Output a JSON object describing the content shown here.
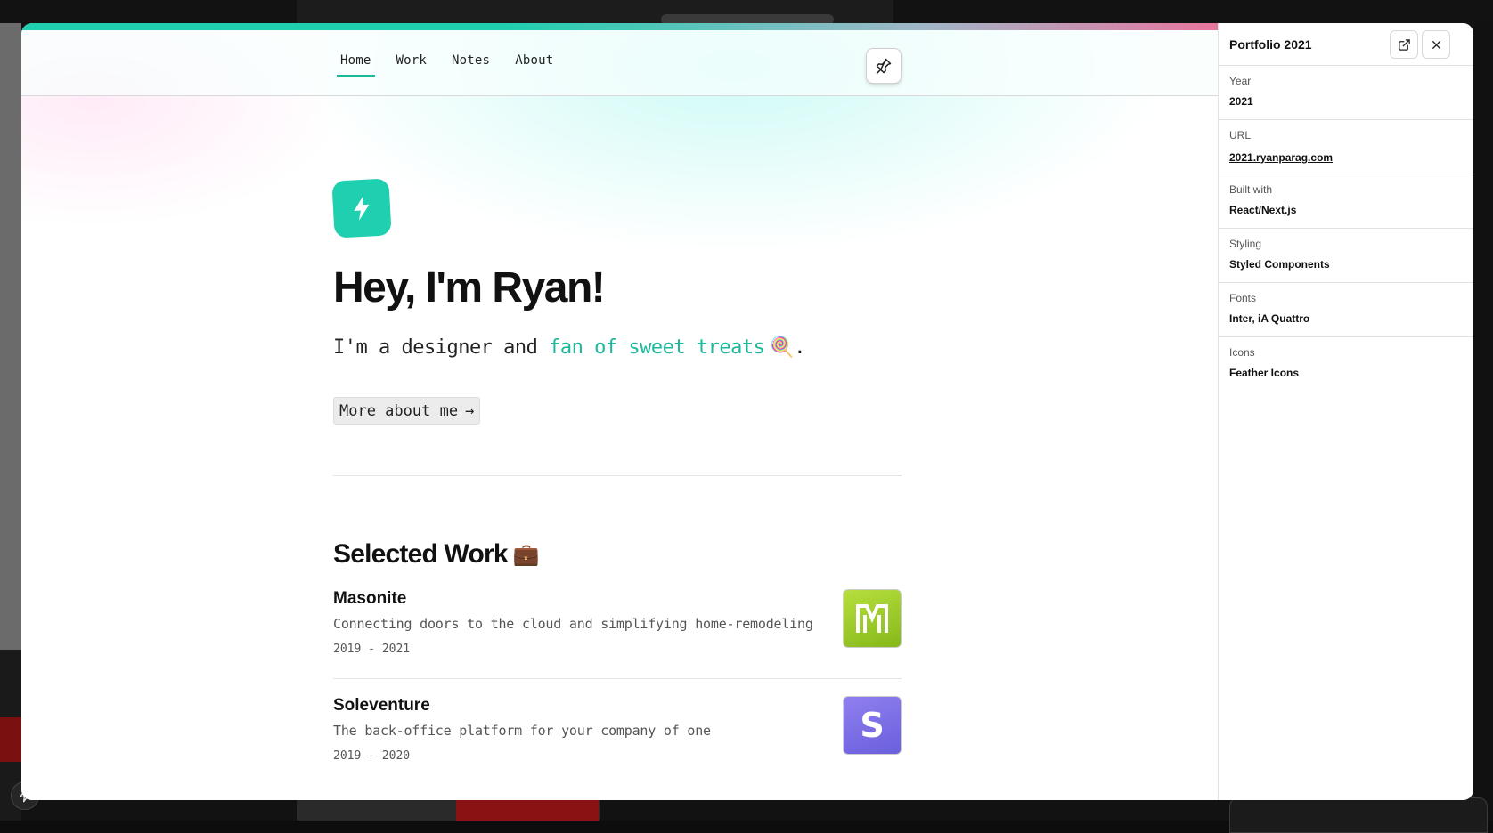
{
  "site": {
    "nav": [
      {
        "label": "Home",
        "active": true
      },
      {
        "label": "Work",
        "active": false
      },
      {
        "label": "Notes",
        "active": false
      },
      {
        "label": "About",
        "active": false
      }
    ],
    "hero": {
      "title": "Hey, I'm Ryan!",
      "subtitle_prefix": "I'm a designer and ",
      "subtitle_accent": "fan of sweet treats",
      "subtitle_emoji": "🍭",
      "subtitle_suffix": ".",
      "button_label": "More about me",
      "button_arrow": "→"
    },
    "selected_work": {
      "title": "Selected Work",
      "emoji": "💼",
      "items": [
        {
          "name": "Masonite",
          "description": "Connecting doors to the cloud and simplifying home-remodeling",
          "years": "2019 - 2021",
          "thumb_color": "#9ccb2a",
          "thumb_icon": "masonite-m-icon"
        },
        {
          "name": "Soleventure",
          "description": "The back-office platform for your company of one",
          "years": "2019 - 2020",
          "thumb_color": "#7a6de8",
          "thumb_icon": "soleventure-s-icon"
        }
      ]
    }
  },
  "panel": {
    "title": "Portfolio 2021",
    "rows": [
      {
        "label": "Year",
        "value": "2021"
      },
      {
        "label": "URL",
        "value": "2021.ryanparag.com"
      },
      {
        "label": "Built with",
        "value": "React/Next.js"
      },
      {
        "label": "Styling",
        "value": "Styled Components"
      },
      {
        "label": "Fonts",
        "value": "Inter, iA Quattro"
      },
      {
        "label": "Icons",
        "value": "Feather Icons"
      }
    ]
  },
  "colors": {
    "accent": "#19b99a",
    "logo": "#1fd0b0"
  }
}
